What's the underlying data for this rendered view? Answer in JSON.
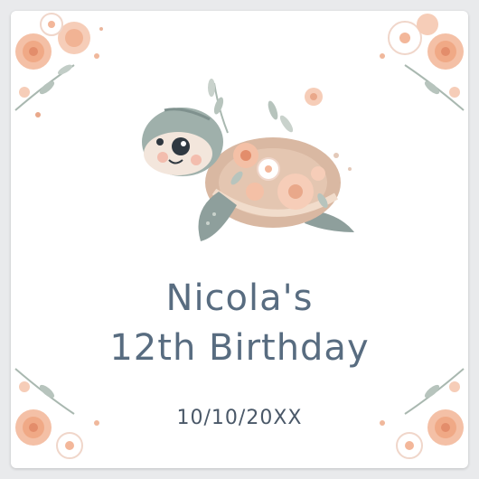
{
  "sticker": {
    "name": "Nicola's",
    "title": "12th Birthday",
    "date": "10/10/20XX"
  },
  "colors": {
    "text": "#586c80",
    "peach": "#f3b79a",
    "leaf": "#9fb0a8",
    "shell": "#d9b8a2",
    "turtle_skin": "#8e9f9c"
  },
  "icons": [
    "floral-corner",
    "sea-turtle-illustration"
  ]
}
